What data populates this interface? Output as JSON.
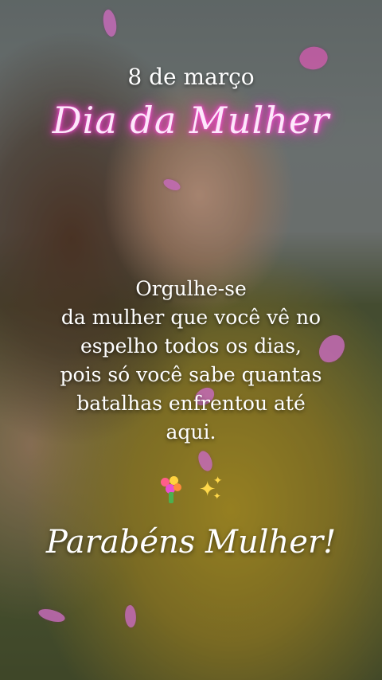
{
  "date_line": "8 de março",
  "title": "Dia da Mulher",
  "message_lines": [
    "Orgulhe-se",
    "da mulher que você vê no",
    "espelho todos os dias,",
    "pois só você sabe quantas",
    "batalhas enfrentou até",
    "aqui."
  ],
  "emojis": [
    "bouquet-icon",
    "sparkles-icon"
  ],
  "closing": "Parabéns Mulher!",
  "colors": {
    "neon_pink": "#ff3fd0",
    "petal": "#c46ab7",
    "text": "#ffffff"
  }
}
